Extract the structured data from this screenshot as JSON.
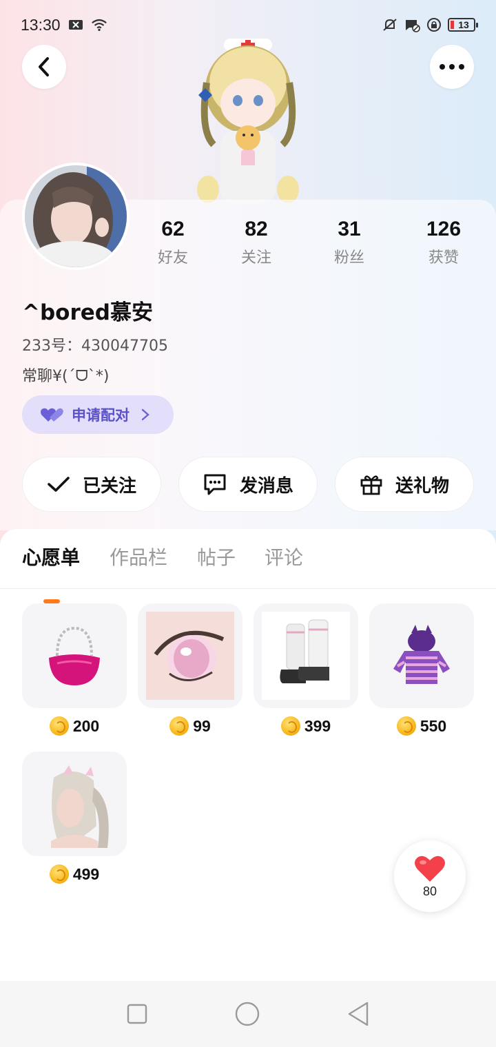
{
  "status_bar": {
    "time": "13:30",
    "battery": "13",
    "icons": [
      "x-notification-icon",
      "wifi-icon",
      "bell-off-icon",
      "message-blocked-icon",
      "rotation-lock-icon",
      "battery-icon"
    ]
  },
  "header": {
    "back_icon": "chevron-left-icon",
    "more_icon": "more-dots-icon"
  },
  "profile": {
    "username": "^bored慕安",
    "id_line": "233号：430047705",
    "bio": "常聊¥(ˊᗜˋ*)",
    "pair_button": "申请配对"
  },
  "stats": [
    {
      "value": "62",
      "label": "好友"
    },
    {
      "value": "82",
      "label": "关注"
    },
    {
      "value": "31",
      "label": "粉丝"
    },
    {
      "value": "126",
      "label": "获赞"
    }
  ],
  "actions": {
    "follow": "已关注",
    "message": "发消息",
    "gift": "送礼物"
  },
  "tabs": [
    {
      "label": "心愿单",
      "active": true
    },
    {
      "label": "作品栏",
      "active": false
    },
    {
      "label": "帖子",
      "active": false
    },
    {
      "label": "评论",
      "active": false
    }
  ],
  "wishlist": [
    {
      "item": "pink-handbag",
      "price": "200"
    },
    {
      "item": "pink-eyes",
      "price": "99"
    },
    {
      "item": "white-boots",
      "price": "399"
    },
    {
      "item": "purple-striped-hoodie",
      "price": "550"
    },
    {
      "item": "silver-ponytail-hair",
      "price": "499"
    }
  ],
  "like": {
    "count": "80",
    "icon": "heart-icon"
  },
  "nav": {
    "icons": [
      "recents-square-icon",
      "home-circle-icon",
      "back-triangle-icon"
    ]
  },
  "colors": {
    "accent_orange": "#ff7a1a",
    "pair_bg": "#e3defa",
    "pair_text": "#5b51c8",
    "like_red": "#f4404a"
  }
}
